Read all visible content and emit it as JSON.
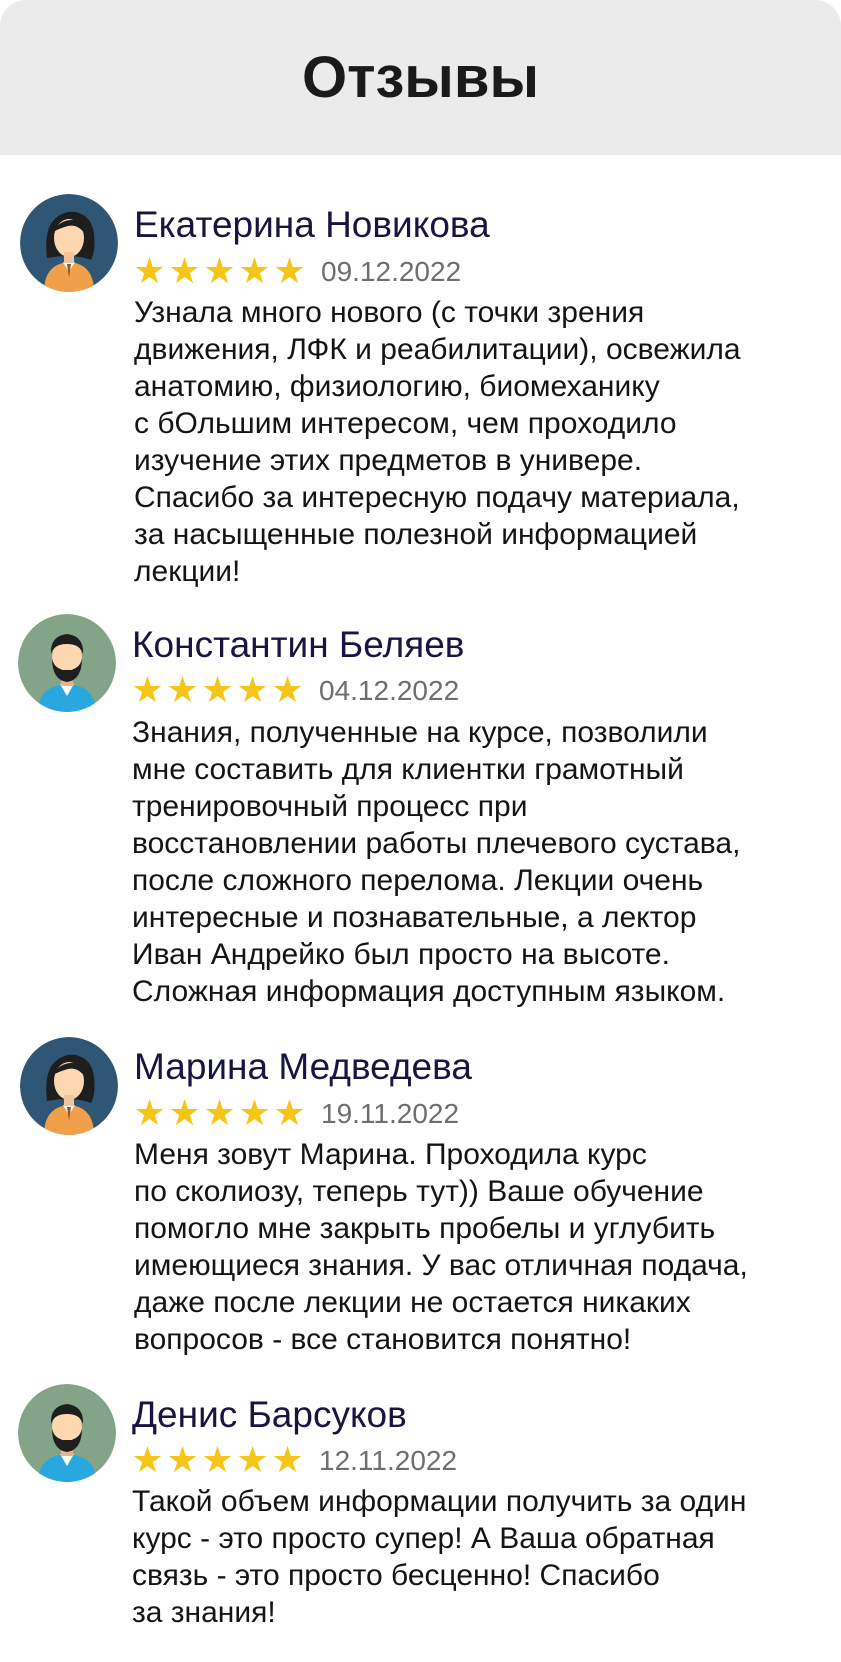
{
  "page": {
    "title": "Отзывы"
  },
  "reviews": [
    {
      "avatar": "female-avatar-icon",
      "name": "Екатерина Новикова",
      "stars": 5,
      "date": "09.12.2022",
      "lines": [
        "Узнала много нового (с точки зрения",
        "движения, ЛФК и реабилитации), освежила",
        "анатомию, физиологию, биомеханику",
        "с бОльшим интересом, чем проходило",
        "изучение этих предметов в универе.",
        "Спасибо за интересную подачу материала,",
        "за насыщенные полезной информацией",
        "лекции!"
      ]
    },
    {
      "avatar": "male-avatar-icon",
      "name": "Константин Беляев",
      "stars": 5,
      "date": "04.12.2022",
      "lines": [
        "Знания, полученные на курсе, позволили",
        "мне составить для клиентки грамотный",
        "тренировочный процесс при",
        "восстановлении работы плечевого сустава,",
        "после сложного перелома. Лекции очень",
        "интересные и познавательные, а лектор",
        "Иван Андрейко был просто на высоте.",
        "Сложная информация доступным языком."
      ]
    },
    {
      "avatar": "female-avatar-icon",
      "name": "Марина Медведева",
      "stars": 5,
      "date": "19.11.2022",
      "lines": [
        "Меня зовут Марина. Проходила курс",
        "по сколиозу, теперь тут)) Ваше обучение",
        "помогло мне закрыть пробелы и углубить",
        "имеющиеся знания. У вас отличная подача,",
        "даже после лекции не остается никаких",
        "вопросов - все становится понятно!"
      ]
    },
    {
      "avatar": "male-avatar-icon",
      "name": "Денис Барсуков",
      "stars": 5,
      "date": "12.11.2022",
      "lines": [
        "Такой объем информации получить за один",
        "курс - это просто супер! А Ваша обратная",
        "связь - это просто бесценно! Спасибо",
        "за знания!"
      ]
    }
  ],
  "colors": {
    "star": "#f5c518",
    "name": "#161640",
    "header_bg": "#ebebeb"
  }
}
